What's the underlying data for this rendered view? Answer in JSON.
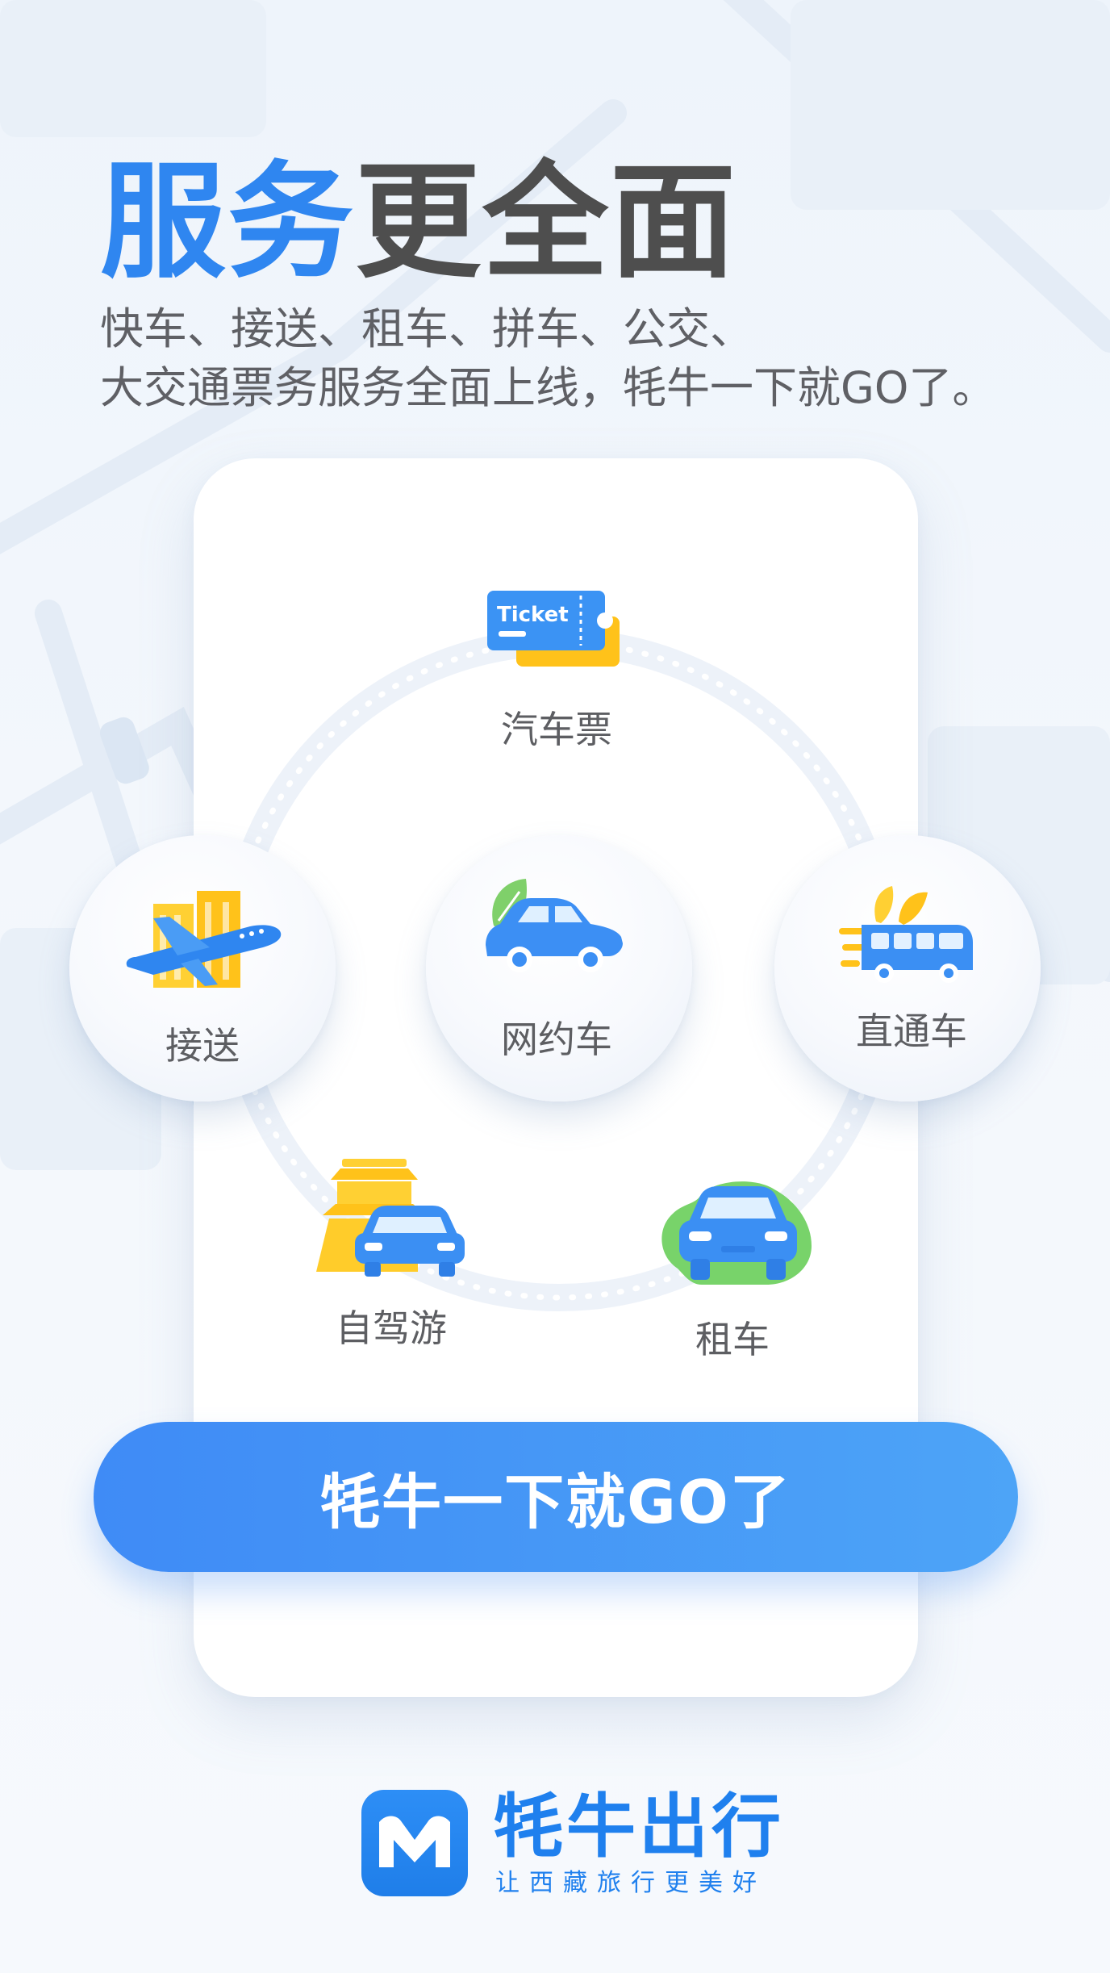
{
  "headline": {
    "accent": "服务",
    "rest": "更全面"
  },
  "subtitle": {
    "line1": "快车、接送、租车、拼车、公交、",
    "line2": "大交通票务服务全面上线，牦牛一下就GO了。"
  },
  "services": {
    "bus_ticket": {
      "label": "汽车票",
      "icon": "ticket-icon",
      "icon_text": "Ticket"
    },
    "ride_hailing": {
      "label": "网约车",
      "icon": "car-leaf-icon"
    },
    "transfer": {
      "label": "接送",
      "icon": "airplane-icon"
    },
    "express_bus": {
      "label": "直通车",
      "icon": "bus-icon"
    },
    "self_drive": {
      "label": "自驾游",
      "icon": "gate-car-icon"
    },
    "rental": {
      "label": "租车",
      "icon": "rental-car-icon"
    }
  },
  "cta": {
    "label": "牦牛一下就GO了"
  },
  "brand": {
    "name": "牦牛出行",
    "slogan": "让西藏旅行更美好",
    "logo_icon": "yak-logo-icon"
  },
  "colors": {
    "accent": "#2f86f0",
    "headline_gray": "#4e4e4e",
    "cta_start": "#3f8bf6",
    "cta_end": "#4da4f7",
    "brand_blue": "#1f80ee"
  }
}
